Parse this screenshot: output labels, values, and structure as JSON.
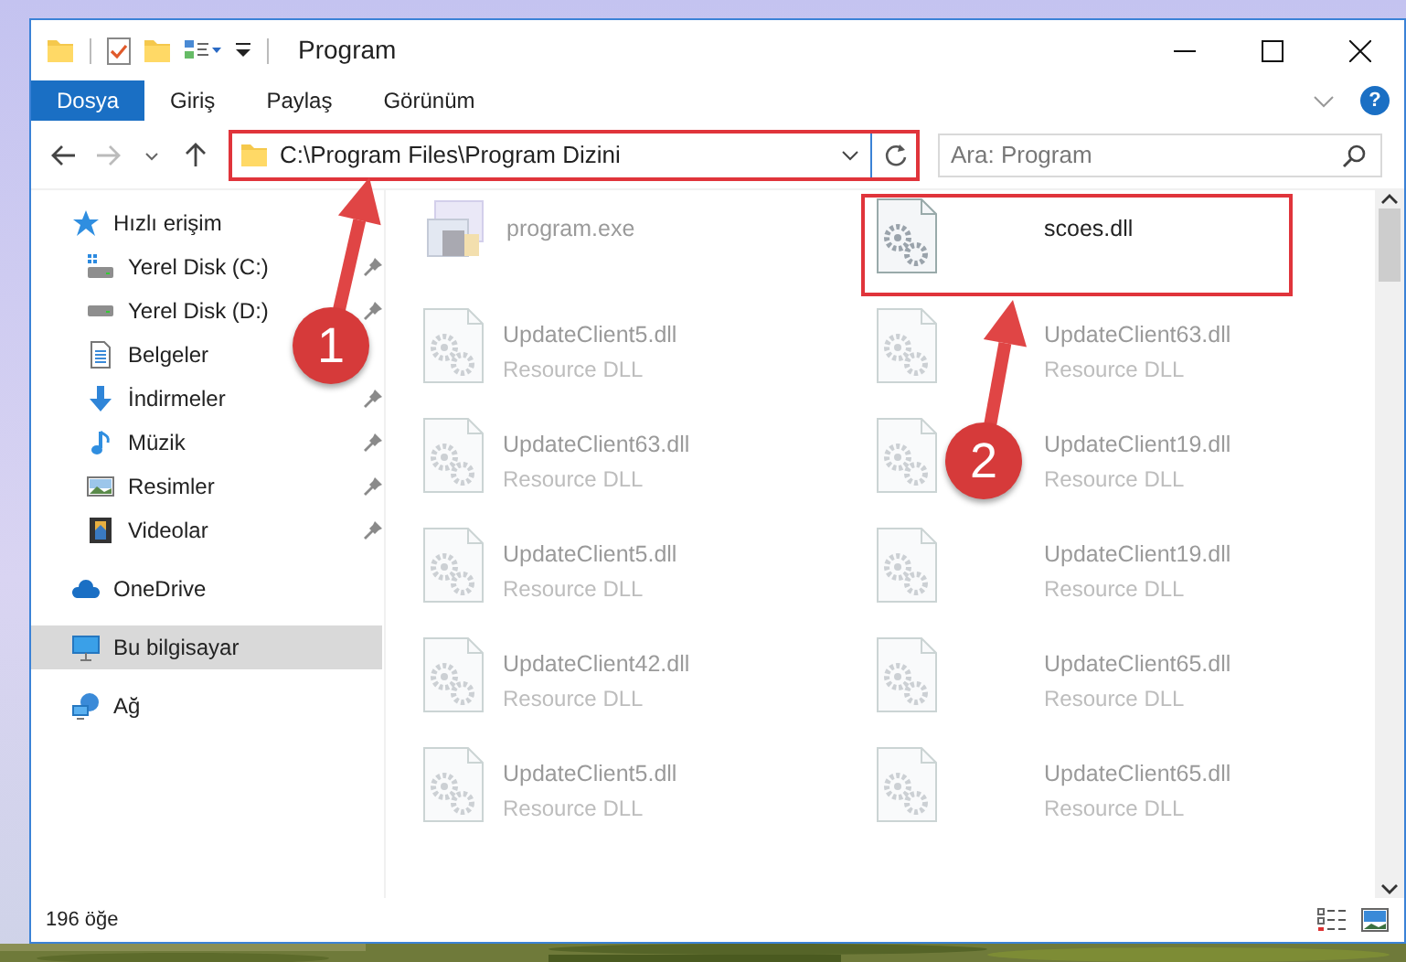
{
  "window": {
    "title": "Program"
  },
  "ribbon_tabs": [
    {
      "label": "Dosya",
      "selected": true
    },
    {
      "label": "Giriş",
      "selected": false
    },
    {
      "label": "Paylaş",
      "selected": false
    },
    {
      "label": "Görünüm",
      "selected": false
    }
  ],
  "help": {
    "label": "?"
  },
  "address_bar": {
    "path": "C:\\Program Files\\Program Dizini",
    "highlighted": true
  },
  "search": {
    "placeholder": "Ara: Program"
  },
  "sidebar": {
    "items": [
      {
        "label": "Hızlı erişim",
        "kind": "star",
        "pinned": false,
        "selected": false,
        "children": [
          {
            "label": "Yerel Disk (C:)",
            "kind": "drive-c",
            "pinned": true,
            "selected": false
          },
          {
            "label": "Yerel Disk (D:)",
            "kind": "drive",
            "pinned": true,
            "selected": false
          },
          {
            "label": "Belgeler",
            "kind": "documents",
            "pinned": false,
            "selected": false
          },
          {
            "label": "İndirmeler",
            "kind": "downloads",
            "pinned": true,
            "selected": false
          },
          {
            "label": "Müzik",
            "kind": "music",
            "pinned": true,
            "selected": false
          },
          {
            "label": "Resimler",
            "kind": "pictures",
            "pinned": true,
            "selected": false
          },
          {
            "label": "Videolar",
            "kind": "videos",
            "pinned": true,
            "selected": false
          }
        ]
      },
      {
        "label": "OneDrive",
        "kind": "cloud",
        "pinned": false,
        "selected": false
      },
      {
        "label": "Bu bilgisayar",
        "kind": "computer",
        "pinned": false,
        "selected": true
      },
      {
        "label": "Ağ",
        "kind": "network",
        "pinned": false,
        "selected": false
      }
    ]
  },
  "files": [
    {
      "name": "program.exe",
      "kind": "exe",
      "dimmed": true,
      "highlighted": false
    },
    {
      "name": "scoes.dll",
      "kind": "dll",
      "dimmed": false,
      "highlighted": true
    },
    {
      "name": "UpdateClient5.dll",
      "type": "Resource DLL",
      "kind": "dll",
      "dimmed": true,
      "highlighted": false
    },
    {
      "name": "UpdateClient63.dll",
      "type": "Resource DLL",
      "kind": "dll",
      "dimmed": true,
      "highlighted": false
    },
    {
      "name": "UpdateClient63.dll",
      "type": "Resource DLL",
      "kind": "dll",
      "dimmed": true,
      "highlighted": false
    },
    {
      "name": "UpdateClient19.dll",
      "type": "Resource DLL",
      "kind": "dll",
      "dimmed": true,
      "highlighted": false
    },
    {
      "name": "UpdateClient5.dll",
      "type": "Resource DLL",
      "kind": "dll",
      "dimmed": true,
      "highlighted": false
    },
    {
      "name": "UpdateClient19.dll",
      "type": "Resource DLL",
      "kind": "dll",
      "dimmed": true,
      "highlighted": false
    },
    {
      "name": "UpdateClient42.dll",
      "type": "Resource DLL",
      "kind": "dll",
      "dimmed": true,
      "highlighted": false
    },
    {
      "name": "UpdateClient65.dll",
      "type": "Resource DLL",
      "kind": "dll",
      "dimmed": true,
      "highlighted": false
    },
    {
      "name": "UpdateClient5.dll",
      "type": "Resource DLL",
      "kind": "dll",
      "dimmed": true,
      "highlighted": false
    },
    {
      "name": "UpdateClient65.dll",
      "type": "Resource DLL",
      "kind": "dll",
      "dimmed": true,
      "highlighted": false
    }
  ],
  "status_bar": {
    "item_count": "196 öğe"
  },
  "annotations": [
    {
      "number": "1"
    },
    {
      "number": "2"
    }
  ]
}
